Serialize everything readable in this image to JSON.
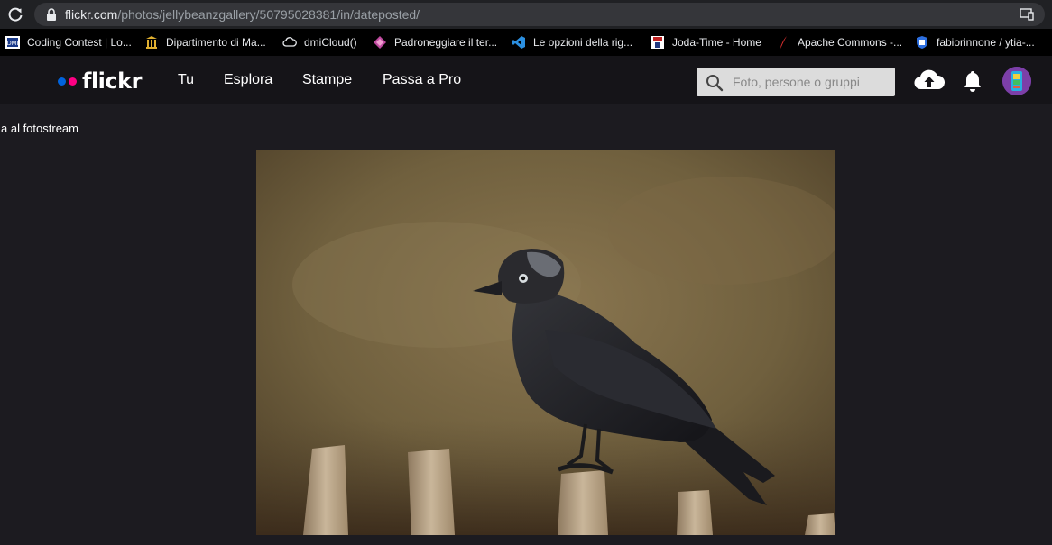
{
  "browser": {
    "url_host": "flickr.com",
    "url_path": "/photos/jellybeanzgallery/50795028381/in/dateposted/"
  },
  "bookmarks": [
    {
      "label": "Coding Contest | Lo...",
      "icon": "dmi-icon"
    },
    {
      "label": "Dipartimento di Ma...",
      "icon": "university-icon"
    },
    {
      "label": "dmiCloud()",
      "icon": "cloud-icon"
    },
    {
      "label": "Padroneggiare il ter...",
      "icon": "diamond-icon"
    },
    {
      "label": "Le opzioni della rig...",
      "icon": "vscode-icon"
    },
    {
      "label": "Joda-Time - Home",
      "icon": "joda-icon"
    },
    {
      "label": "Apache Commons -...",
      "icon": "feather-icon"
    },
    {
      "label": "fabiorinnone / ytia-...",
      "icon": "shield-icon"
    }
  ],
  "header": {
    "logo": "flickr",
    "nav": [
      "Tu",
      "Esplora",
      "Stampe",
      "Passa a Pro"
    ],
    "search_placeholder": "Foto, persone o gruppi"
  },
  "content": {
    "back_link": "a al fotostream"
  },
  "colors": {
    "flickr_blue": "#0063dc",
    "flickr_pink": "#ff0084",
    "header_bg": "#151418",
    "page_bg": "#1c1b20"
  }
}
